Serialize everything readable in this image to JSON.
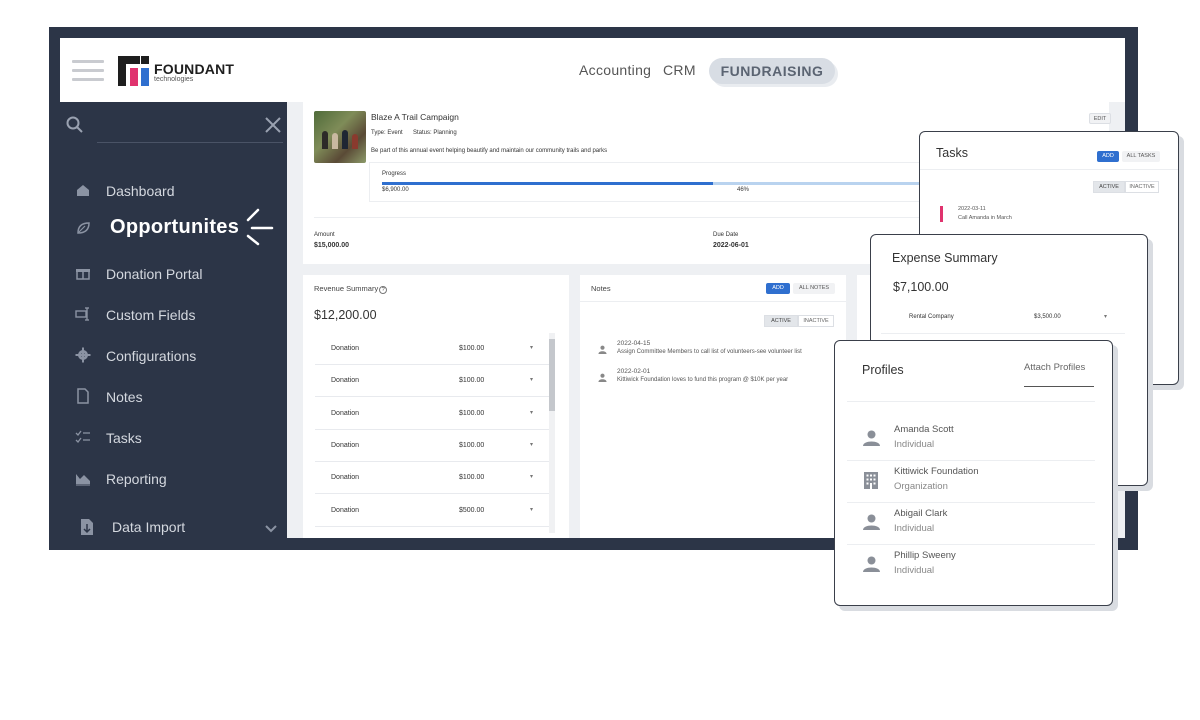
{
  "brand": {
    "name": "FOUNDANT",
    "sub": "technologies"
  },
  "topnav": {
    "accounting": "Accounting",
    "crm": "CRM",
    "fundraising": "FUNDRAISING"
  },
  "sidebar": {
    "items": [
      {
        "label": "Dashboard",
        "icon": "home-icon"
      },
      {
        "label": "Opportunites",
        "icon": "leaf-icon",
        "active": true
      },
      {
        "label": "Donation Portal",
        "icon": "gift-icon"
      },
      {
        "label": "Custom Fields",
        "icon": "fields-icon"
      },
      {
        "label": "Configurations",
        "icon": "gear-icon"
      },
      {
        "label": "Notes",
        "icon": "note-icon"
      },
      {
        "label": "Tasks",
        "icon": "tasks-icon"
      },
      {
        "label": "Reporting",
        "icon": "chart-icon"
      },
      {
        "label": "Data Import",
        "icon": "import-icon"
      }
    ]
  },
  "campaign": {
    "title": "Blaze A Trail Campaign",
    "type": "Type: Event",
    "status": "Status: Planning",
    "description": "Be part of this annual event helping beautify and maintain our community trails and parks",
    "edit": "EDIT",
    "progress_label": "Progress",
    "progress_amount": "$6,900.00",
    "progress_pct_text": "46%",
    "progress_value": 0.46,
    "amount_label": "Amount",
    "amount_value": "$15,000.00",
    "due_label": "Due Date",
    "due_value": "2022-06-01"
  },
  "revenue": {
    "title": "Revenue Summary",
    "help": "?",
    "total": "$12,200.00",
    "rows": [
      {
        "type": "Donation",
        "amount": "$100.00"
      },
      {
        "type": "Donation",
        "amount": "$100.00"
      },
      {
        "type": "Donation",
        "amount": "$100.00"
      },
      {
        "type": "Donation",
        "amount": "$100.00"
      },
      {
        "type": "Donation",
        "amount": "$100.00"
      },
      {
        "type": "Donation",
        "amount": "$500.00"
      }
    ]
  },
  "notes": {
    "title": "Notes",
    "add": "ADD",
    "all": "ALL NOTES",
    "active": "ACTIVE",
    "inactive": "INACTIVE",
    "items": [
      {
        "date": "2022-04-15",
        "text": "Assign Committee Members to call list of volunteers-see volunteer list"
      },
      {
        "date": "2022-02-01",
        "text": "Kittiwick Foundation loves to fund this program @ $10K per year"
      }
    ]
  },
  "tasks": {
    "title": "Tasks",
    "add": "ADD",
    "all": "ALL TASKS",
    "active": "ACTIVE",
    "inactive": "INACTIVE",
    "items": [
      {
        "date": "2022-03-11",
        "text": "Call Amanda in March"
      }
    ]
  },
  "expense": {
    "title": "Expense Summary",
    "total": "$7,100.00",
    "rows": [
      {
        "name": "Rental Company",
        "amount": "$3,500.00"
      }
    ]
  },
  "profiles": {
    "title": "Profiles",
    "attach": "Attach Profiles",
    "items": [
      {
        "name": "Amanda Scott",
        "kind": "Individual",
        "icon": "person-icon"
      },
      {
        "name": "Kittiwick Foundation",
        "kind": "Organization",
        "icon": "building-icon"
      },
      {
        "name": "Abigail Clark",
        "kind": "Individual",
        "icon": "person-icon"
      },
      {
        "name": "Phillip Sweeny",
        "kind": "Individual",
        "icon": "person-icon"
      }
    ]
  },
  "colors": {
    "frame": "#2c3547",
    "accent": "#2f6fcf",
    "task_marker": "#e0336e"
  }
}
